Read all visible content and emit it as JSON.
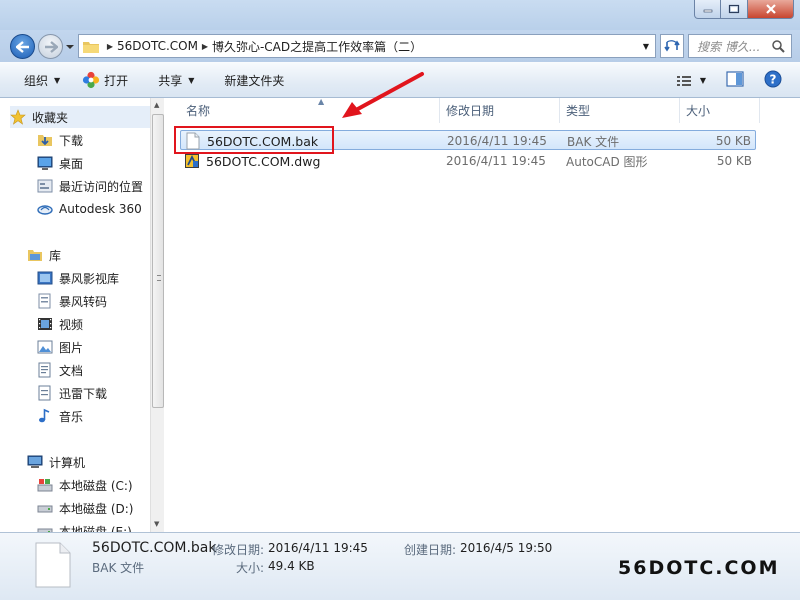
{
  "window": {
    "address": [
      "56DOTC.COM",
      "博久弥心-CAD之提高工作效率篇（二）"
    ],
    "search_placeholder": "搜索 博久..."
  },
  "toolbar": {
    "organize": "组织",
    "open": "打开",
    "share": "共享",
    "new_folder": "新建文件夹"
  },
  "nav": {
    "favorites": "收藏夹",
    "downloads": "下载",
    "desktop": "桌面",
    "recent": "最近访问的位置",
    "autodesk": "Autodesk 360",
    "libraries": "库",
    "baofeng_lib": "暴风影视库",
    "baofeng_conv": "暴风转码",
    "videos": "视频",
    "pictures": "图片",
    "documents": "文档",
    "xunlei": "迅雷下载",
    "music": "音乐",
    "computer": "计算机",
    "disk_c": "本地磁盘 (C:)",
    "disk_d": "本地磁盘 (D:)",
    "disk_e": "本地磁盘 (E:)"
  },
  "columns": {
    "name": "名称",
    "modified": "修改日期",
    "type": "类型",
    "size": "大小"
  },
  "files": [
    {
      "name": "56DOTC.COM.bak",
      "modified": "2016/4/11 19:45",
      "type": "BAK 文件",
      "size": "50 KB"
    },
    {
      "name": "56DOTC.COM.dwg",
      "modified": "2016/4/11 19:45",
      "type": "AutoCAD 图形",
      "size": "50 KB"
    }
  ],
  "details": {
    "name": "56DOTC.COM.bak",
    "type": "BAK 文件",
    "modified_label": "修改日期:",
    "modified_value": "2016/4/11 19:45",
    "created_label": "创建日期:",
    "created_value": "2016/4/5 19:50",
    "size_label": "大小:",
    "size_value": "49.4 KB"
  },
  "watermark": "56DOTC.COM",
  "colors": {
    "annotation": "#e1151d",
    "selection": "#d3e6fb"
  }
}
